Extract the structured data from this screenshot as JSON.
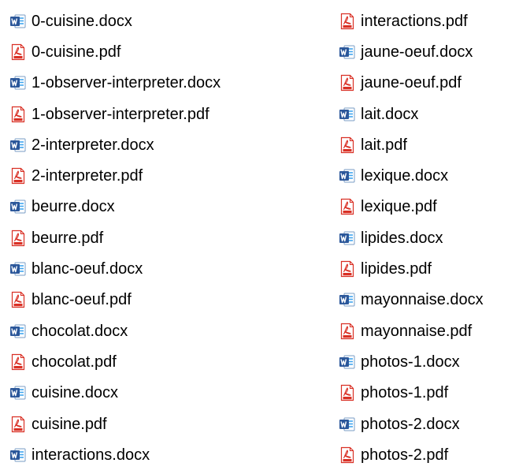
{
  "colors": {
    "word_blue": "#2b579a",
    "word_light": "#41a5ee",
    "pdf_red": "#d93025",
    "text": "#000000",
    "background": "#ffffff"
  },
  "icons": {
    "docx": "word-document-icon",
    "pdf": "pdf-document-icon"
  },
  "files": {
    "left": [
      {
        "name": "0-cuisine.docx",
        "type": "docx"
      },
      {
        "name": "0-cuisine.pdf",
        "type": "pdf"
      },
      {
        "name": "1-observer-interpreter.docx",
        "type": "docx"
      },
      {
        "name": "1-observer-interpreter.pdf",
        "type": "pdf"
      },
      {
        "name": "2-interpreter.docx",
        "type": "docx"
      },
      {
        "name": "2-interpreter.pdf",
        "type": "pdf"
      },
      {
        "name": "beurre.docx",
        "type": "docx"
      },
      {
        "name": "beurre.pdf",
        "type": "pdf"
      },
      {
        "name": "blanc-oeuf.docx",
        "type": "docx"
      },
      {
        "name": "blanc-oeuf.pdf",
        "type": "pdf"
      },
      {
        "name": "chocolat.docx",
        "type": "docx"
      },
      {
        "name": "chocolat.pdf",
        "type": "pdf"
      },
      {
        "name": "cuisine.docx",
        "type": "docx"
      },
      {
        "name": "cuisine.pdf",
        "type": "pdf"
      },
      {
        "name": "interactions.docx",
        "type": "docx"
      }
    ],
    "right": [
      {
        "name": "interactions.pdf",
        "type": "pdf"
      },
      {
        "name": "jaune-oeuf.docx",
        "type": "docx"
      },
      {
        "name": "jaune-oeuf.pdf",
        "type": "pdf"
      },
      {
        "name": "lait.docx",
        "type": "docx"
      },
      {
        "name": "lait.pdf",
        "type": "pdf"
      },
      {
        "name": "lexique.docx",
        "type": "docx"
      },
      {
        "name": "lexique.pdf",
        "type": "pdf"
      },
      {
        "name": "lipides.docx",
        "type": "docx"
      },
      {
        "name": "lipides.pdf",
        "type": "pdf"
      },
      {
        "name": "mayonnaise.docx",
        "type": "docx"
      },
      {
        "name": "mayonnaise.pdf",
        "type": "pdf"
      },
      {
        "name": "photos-1.docx",
        "type": "docx"
      },
      {
        "name": "photos-1.pdf",
        "type": "pdf"
      },
      {
        "name": "photos-2.docx",
        "type": "docx"
      },
      {
        "name": "photos-2.pdf",
        "type": "pdf"
      }
    ]
  }
}
